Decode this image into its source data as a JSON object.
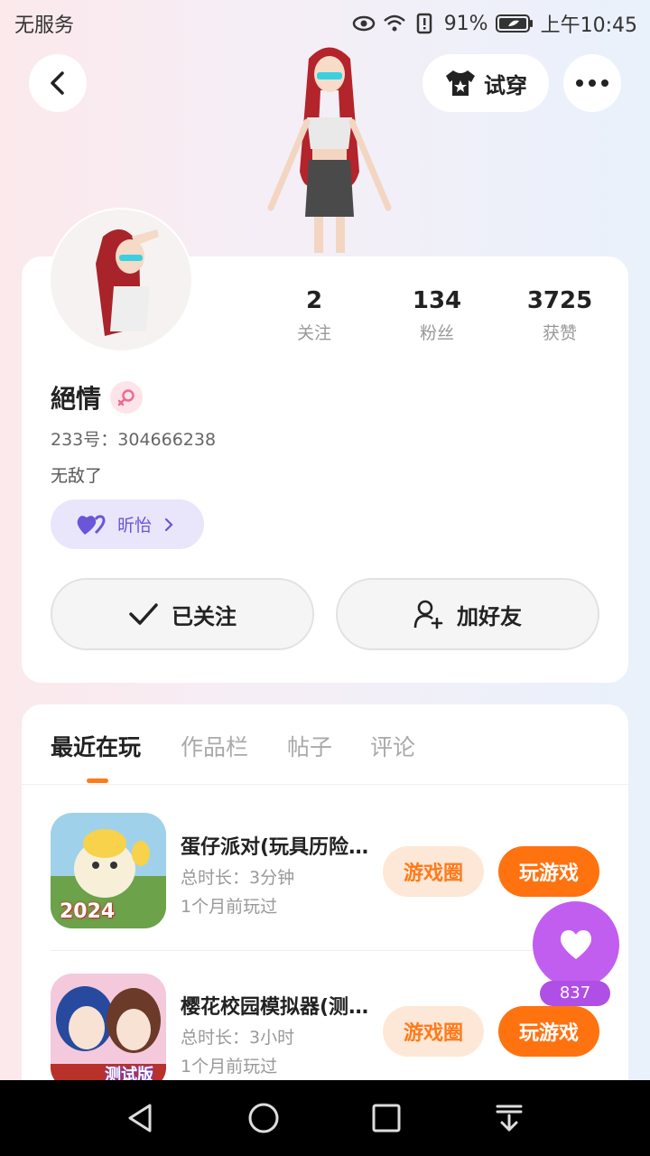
{
  "status_bar": {
    "carrier": "无服务",
    "battery": "91%",
    "time": "上午10:45"
  },
  "header": {
    "try_on_label": "试穿"
  },
  "profile": {
    "stats": [
      {
        "value": "2",
        "label": "关注"
      },
      {
        "value": "134",
        "label": "粉丝"
      },
      {
        "value": "3725",
        "label": "获赞"
      }
    ],
    "username": "絕情",
    "uid": "233号：304666238",
    "bio": "无敌了",
    "relation_tag": "昕怡",
    "follow_label": "已关注",
    "add_friend_label": "加好友"
  },
  "tabs": [
    {
      "label": "最近在玩",
      "active": true
    },
    {
      "label": "作品栏",
      "active": false
    },
    {
      "label": "帖子",
      "active": false
    },
    {
      "label": "评论",
      "active": false
    }
  ],
  "games": [
    {
      "title": "蛋仔派对(玩具历险记)",
      "duration": "总时长：3分钟",
      "last_played": "1个月前玩过",
      "circle_label": "游戏圈",
      "play_label": "玩游戏",
      "icon_text": "2024"
    },
    {
      "title": "樱花校园模拟器(测试版)",
      "duration": "总时长：3小时",
      "last_played": "1个月前玩过",
      "circle_label": "游戏圈",
      "play_label": "玩游戏",
      "icon_text": "测试版"
    }
  ],
  "like_fab": {
    "count": "837"
  },
  "colors": {
    "accent_orange": "#ff7210",
    "accent_purple": "#c15ef0",
    "relation_purple": "#6b55d9"
  }
}
